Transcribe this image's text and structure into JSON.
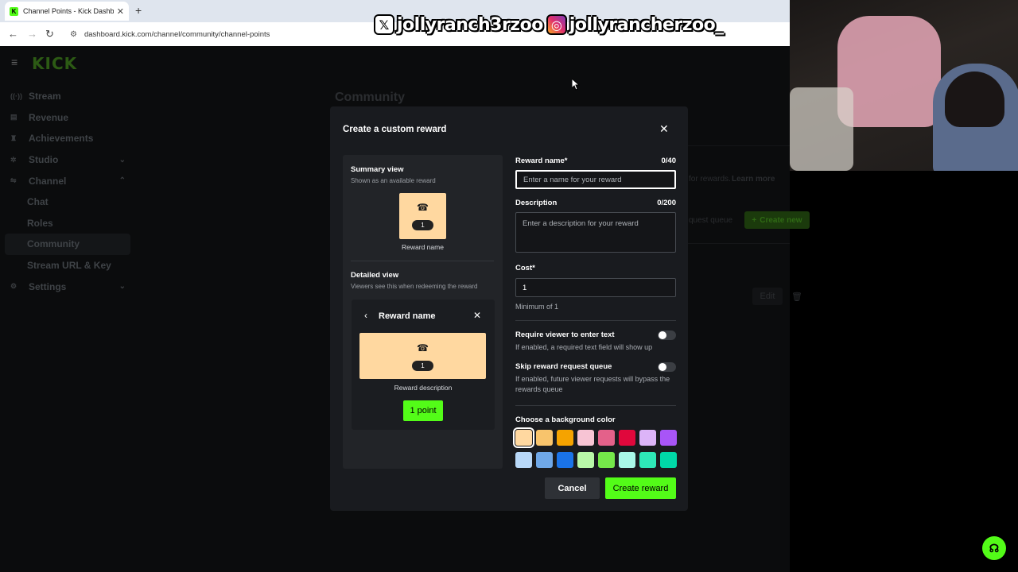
{
  "browser": {
    "tab_title": "Channel Points - Kick Dashboard",
    "tab_favicon": "K",
    "new_tab": "+",
    "url": "dashboard.kick.com/channel/community/channel-points"
  },
  "overlay": {
    "x_handle": "jollyranch3rzoo",
    "ig_handle": "jollyrancherzoo_"
  },
  "dashboard": {
    "logo": "KICK",
    "nav": [
      {
        "label": "Stream",
        "icon": "broadcast-icon"
      },
      {
        "label": "Revenue",
        "icon": "revenue-icon"
      },
      {
        "label": "Achievements",
        "icon": "trophy-icon"
      },
      {
        "label": "Studio",
        "icon": "studio-icon"
      },
      {
        "label": "Channel",
        "icon": "channel-icon"
      },
      {
        "label": "Chat"
      },
      {
        "label": "Roles"
      },
      {
        "label": "Community"
      },
      {
        "label": "Stream URL & Key"
      },
      {
        "label": "Settings",
        "icon": "gear-icon"
      }
    ],
    "page_title": "Community",
    "bg_hint": "for rewards.",
    "bg_learn_more": "Learn more",
    "bg_queue": "quest queue",
    "bg_create_new": "Create new",
    "bg_edit": "Edit"
  },
  "modal": {
    "title": "Create a custom reward",
    "summary_title": "Summary view",
    "summary_sub": "Shown as an available reward",
    "summary_cost": "1",
    "summary_name": "Reward name",
    "detailed_title": "Detailed view",
    "detailed_sub": "Viewers see this when redeeming the reward",
    "detail_name": "Reward name",
    "detail_cost": "1",
    "detail_desc": "Reward description",
    "point_button": "1 point",
    "reward_name_label": "Reward name*",
    "reward_name_count": "0/40",
    "reward_name_placeholder": "Enter a name for your reward",
    "description_label": "Description",
    "description_count": "0/200",
    "description_placeholder": "Enter a description for your reward",
    "cost_label": "Cost*",
    "cost_value": "1",
    "cost_help": "Minimum of 1",
    "require_text_label": "Require viewer to enter text",
    "require_text_help": "If enabled, a required text field will show up",
    "skip_queue_label": "Skip reward request queue",
    "skip_queue_help": "If enabled, future viewer requests will bypass the rewards queue",
    "color_label": "Choose a background color",
    "colors": [
      "#ffd8a0",
      "#f8c46c",
      "#f5a300",
      "#f7c4d4",
      "#e4618a",
      "#e0083c",
      "#dcb4f8",
      "#a855f7",
      "#b8d8f8",
      "#6fa8e8",
      "#1a73e8",
      "#b8f8a8",
      "#75e84a",
      "#a8f8e8",
      "#2ee8b8",
      "#00d8a8"
    ],
    "cancel": "Cancel",
    "create": "Create reward"
  }
}
